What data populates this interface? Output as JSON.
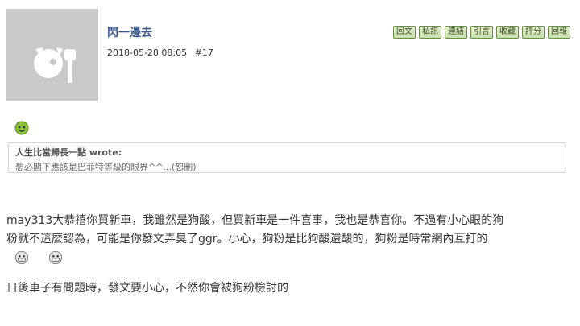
{
  "user": {
    "name": "閃一邊去",
    "timestamp": "2018-05-28 08:05",
    "post_number": "#17"
  },
  "actions": [
    "回文",
    "私訊",
    "連結",
    "引言",
    "收藏",
    "評分",
    "回報"
  ],
  "quote": {
    "author": "人生比當歸長一點 wrote:",
    "text": "想必閣下應該是巴菲特等級的眼界^^...(恕刪)"
  },
  "post": {
    "line1": "may313大恭禧你買新車，我雖然是狗酸，但買新車是一件喜事，我也是恭喜你。不過有小心眼的狗",
    "line2": "粉就不這麼認為，可能是你發文弄臭了ggr。小心，狗粉是比狗酸還酸的，狗粉是時常網內互打的",
    "line3": "日後車子有問題時，發文要小心，不然你會被狗粉檢討的"
  },
  "colors": {
    "accent_button": "#c9dfae",
    "username": "#3b5a8a",
    "emoji_green": "#8fc23a"
  },
  "icons": {
    "avatar": "default-avatar-icon",
    "emoji_top": "green-devil-emoji-icon",
    "emoji_row": [
      "grinning-emoji-icon",
      "grinning-emoji-icon"
    ]
  }
}
